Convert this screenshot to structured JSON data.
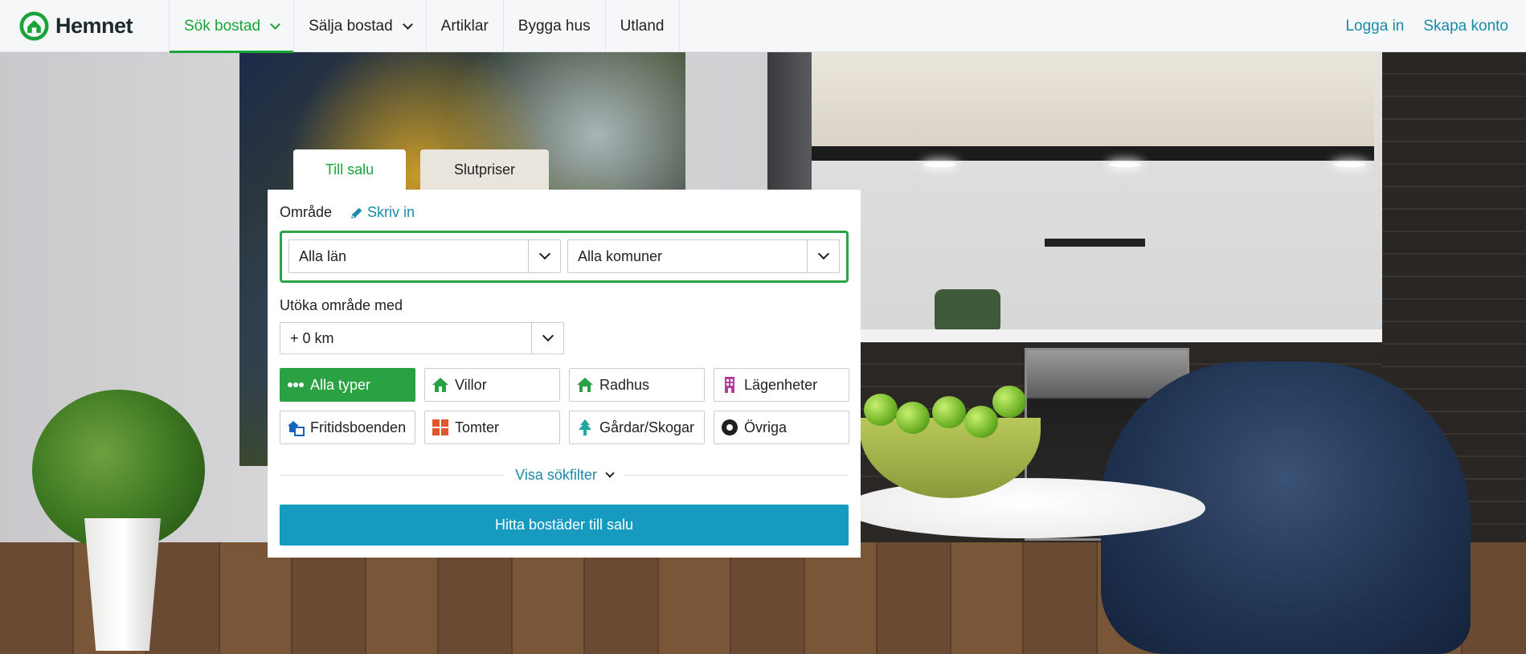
{
  "header": {
    "brand": "Hemnet",
    "nav": [
      {
        "label": "Sök bostad",
        "active": true,
        "dropdown": true
      },
      {
        "label": "Sälja bostad",
        "active": false,
        "dropdown": true
      },
      {
        "label": "Artiklar",
        "active": false,
        "dropdown": false
      },
      {
        "label": "Bygga hus",
        "active": false,
        "dropdown": false
      },
      {
        "label": "Utland",
        "active": false,
        "dropdown": false
      }
    ],
    "login": "Logga in",
    "create_account": "Skapa konto"
  },
  "search": {
    "tabs": [
      "Till salu",
      "Slutpriser"
    ],
    "active_tab": "Till salu",
    "area_label": "Område",
    "write_link": "Skriv in",
    "county_value": "Alla län",
    "municipality_value": "Alla komuner",
    "expand_label": "Utöka område med",
    "expand_value": "+ 0 km",
    "types": [
      {
        "label": "Alla typer",
        "icon": "dots-icon",
        "active": true
      },
      {
        "label": "Villor",
        "icon": "house-icon",
        "active": false
      },
      {
        "label": "Radhus",
        "icon": "rowhouse-icon",
        "active": false
      },
      {
        "label": "Lägenheter",
        "icon": "apartment-building-icon",
        "active": false
      },
      {
        "label": "Fritidsboenden",
        "icon": "holiday-home-icon",
        "active": false
      },
      {
        "label": "Tomter",
        "icon": "plot-icon",
        "active": false
      },
      {
        "label": "Gårdar/Skogar",
        "icon": "tree-icon",
        "active": false
      },
      {
        "label": "Övriga",
        "icon": "circle-dot-icon",
        "active": false
      }
    ],
    "filter_link": "Visa sökfilter",
    "submit": "Hitta bostäder till salu"
  },
  "colors": {
    "brand_green": "#19a339",
    "link_blue": "#1a8aa8",
    "button_blue": "#169abf"
  }
}
